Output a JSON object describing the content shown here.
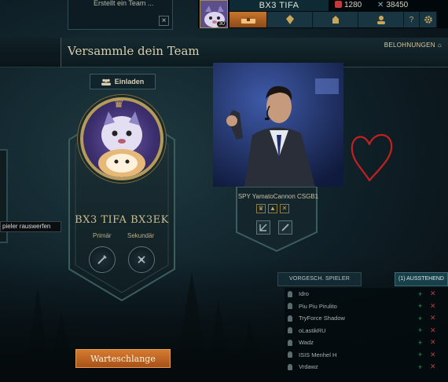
{
  "notification": {
    "text": "Erstellt ein Team ...",
    "close": "×"
  },
  "topbar": {
    "summoner_name": "BX3 TIFA",
    "level": "30",
    "riot_points": "1280",
    "blue_essence": "38450",
    "nav": [
      {
        "icon": "store-chest-icon"
      },
      {
        "icon": "crystal-icon"
      },
      {
        "icon": "champion-icon"
      },
      {
        "icon": "profile-icon"
      },
      {
        "icon": "help-icon",
        "label": "?"
      },
      {
        "icon": "gear-icon"
      }
    ]
  },
  "header": {
    "title": "Versammle dein Team",
    "rewards": "BELOHNUNGEN"
  },
  "lobby": {
    "invite_label": "Einladen",
    "player_name": "BX3 TIFA BX3EK",
    "primary_label": "Primär",
    "secondary_label": "Sekundär",
    "kick_tooltip": "pieler rauswerfen",
    "queue_button": "Warteschlange"
  },
  "member": {
    "name": "SPY YamatoCannon CSGB1",
    "mini_icons": [
      "crown-icon",
      "fire-icon",
      "close-icon"
    ]
  },
  "friends_panel": {
    "tab_suggested": "VORGESCH. SPIELER",
    "tab_pending": "(1) AUSSTEHEND",
    "friends": [
      {
        "name": "Idro"
      },
      {
        "name": "Piu Piu Pirulito"
      },
      {
        "name": "TryForce Shadow"
      },
      {
        "name": "oLastikRU"
      },
      {
        "name": "Wadz"
      },
      {
        "name": "ISIS Menhel H"
      },
      {
        "name": "Vrdawz"
      }
    ]
  },
  "colors": {
    "gold": "#cdbe91",
    "queue_orange": "#d57b2f",
    "header_bg": "#152a30",
    "heart_red": "#c42020"
  }
}
